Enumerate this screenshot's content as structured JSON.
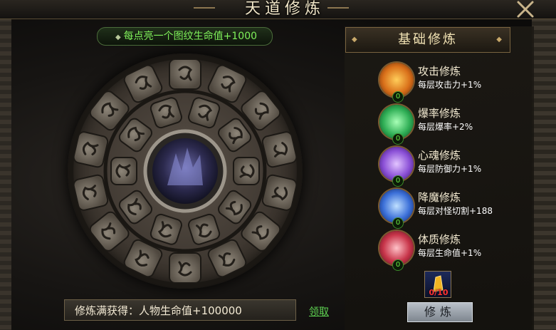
{
  "window": {
    "title": "天道修炼"
  },
  "hint": {
    "text": "每点亮一个图纹生命值+1000"
  },
  "panel": {
    "title": "基础修炼"
  },
  "skills": [
    {
      "name": "攻击修炼",
      "desc": "每层攻击力+1%",
      "level": "0",
      "icon": "fire-icon",
      "color": "#e07a1e"
    },
    {
      "name": "爆率修炼",
      "desc": "每层爆率+2%",
      "level": "0",
      "icon": "eye-icon",
      "color": "#2fb15a"
    },
    {
      "name": "心魂修炼",
      "desc": "每层防御力+1%",
      "level": "0",
      "icon": "soul-icon",
      "color": "#8a4fd6"
    },
    {
      "name": "降魔修炼",
      "desc": "每层对怪切割+188",
      "level": "0",
      "icon": "demon-icon",
      "color": "#3b6fd8"
    },
    {
      "name": "体质修炼",
      "desc": "每层生命值+1%",
      "level": "0",
      "icon": "heart-icon",
      "color": "#c8354a"
    }
  ],
  "reward": {
    "text": "修炼满获得：人物生命值+100000"
  },
  "claim": {
    "label": "领取"
  },
  "item": {
    "count": "0/10",
    "icon": "crystal-icon"
  },
  "train": {
    "label": "修炼"
  }
}
